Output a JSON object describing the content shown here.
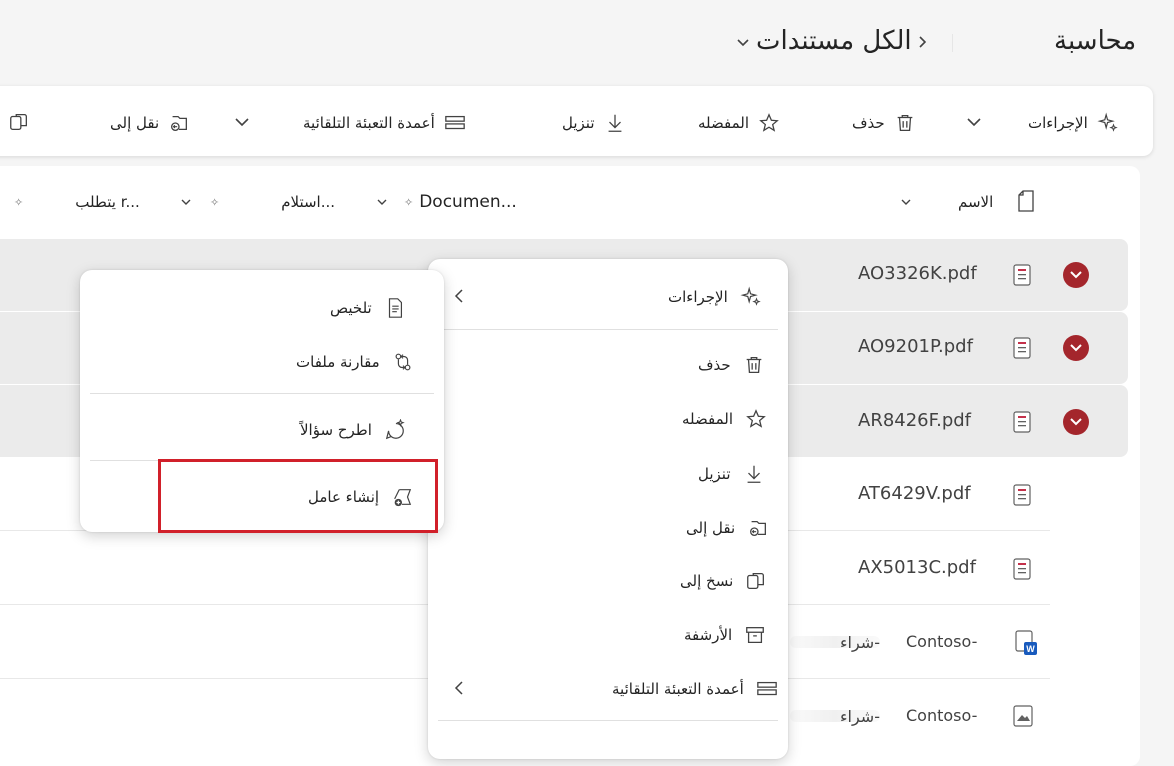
{
  "breadcrumb": {
    "root": "محاسبة",
    "current": "الكل مستندات"
  },
  "toolbar": {
    "actions": "الإجراءات",
    "delete": "حذف",
    "favorite": "المفضله",
    "download": "تنزيل",
    "autofill": "أعمدة التعبئة التلقائية",
    "move_to": "نقل إلى"
  },
  "columns": {
    "name": "الاسم",
    "document": "Documen...",
    "received": "استلام...",
    "requires": "يتطلب r..."
  },
  "rows": [
    {
      "name": "AO3326K.pdf",
      "status": "error",
      "highlight": true
    },
    {
      "name": "AO9201P.pdf",
      "status": "error",
      "highlight": true
    },
    {
      "name": "AR8426F.pdf",
      "status": "error",
      "highlight": true
    },
    {
      "name": "AT6429V.pdf",
      "status": "none",
      "highlight": false
    },
    {
      "name": "AX5013C.pdf",
      "status": "none",
      "highlight": false
    },
    {
      "name": "Contoso-",
      "extra": "شراء-",
      "type": "word",
      "highlight": false
    },
    {
      "name": "Contoso-",
      "extra": "شراء-",
      "type": "image",
      "highlight": false
    }
  ],
  "context_menu": {
    "actions": "الإجراءات",
    "delete": "حذف",
    "favorite": "المفضله",
    "download": "تنزيل",
    "move_to": "نقل إلى",
    "copy_to": "نسخ إلى",
    "archive": "الأرشفة",
    "autofill": "أعمدة التعبئة التلقائية"
  },
  "submenu": {
    "summarize": "تلخيص",
    "compare": "مقارنة ملفات",
    "ask": "اطرح سؤالاً",
    "create_agent": "إنشاء عامل"
  },
  "colors": {
    "status_red": "#a4262c",
    "highlight_box": "#d1202a",
    "row_highlight": "#ebebeb"
  }
}
